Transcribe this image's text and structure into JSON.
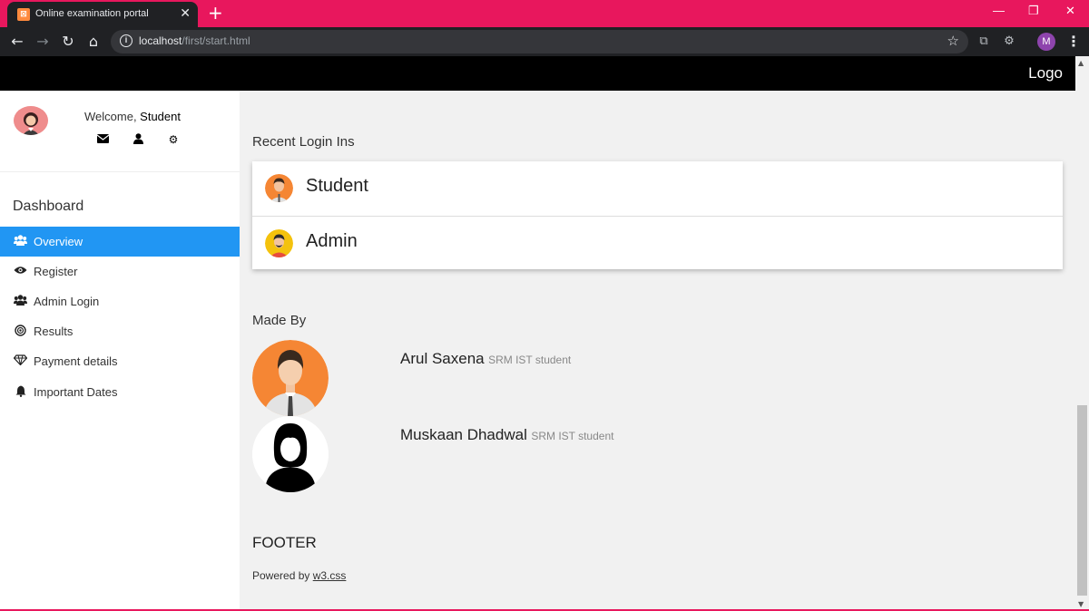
{
  "browser": {
    "tab_title": "Online examination portal",
    "tab_close": "✕",
    "new_tab": "+",
    "url_host": "localhost",
    "url_path": "/first/start.html",
    "profile_initial": "M",
    "window_controls": [
      "—",
      "❐",
      "✕"
    ]
  },
  "topbar": {
    "logo": "Logo"
  },
  "sidebar": {
    "welcome_prefix": "Welcome, ",
    "user_name": "Student",
    "dashboard_title": "Dashboard",
    "items": [
      {
        "label": "Overview",
        "icon": "users-icon",
        "active": true
      },
      {
        "label": "Register",
        "icon": "eye-icon"
      },
      {
        "label": "Admin Login",
        "icon": "users-icon"
      },
      {
        "label": "Results",
        "icon": "bullseye-icon"
      },
      {
        "label": "Payment details",
        "icon": "diamond-icon"
      },
      {
        "label": "Important Dates",
        "icon": "bell-icon"
      }
    ],
    "accent": "#2196f3"
  },
  "main": {
    "recent_title": "Recent Login Ins",
    "logins": [
      {
        "name": "Student",
        "icon": "student-avatar-icon"
      },
      {
        "name": "Admin",
        "icon": "admin-avatar-icon"
      }
    ],
    "made_by_title": "Made By",
    "makers": [
      {
        "name": "Arul Saxena",
        "role": "SRM IST student"
      },
      {
        "name": "Muskaan Dhadwal",
        "role": "SRM IST student"
      }
    ]
  },
  "footer": {
    "title": "FOOTER",
    "powered_prefix": "Powered by ",
    "powered_link": "w3.css"
  },
  "colors": {
    "chrome_accent": "#e8175d",
    "chrome_dark": "#202124"
  }
}
